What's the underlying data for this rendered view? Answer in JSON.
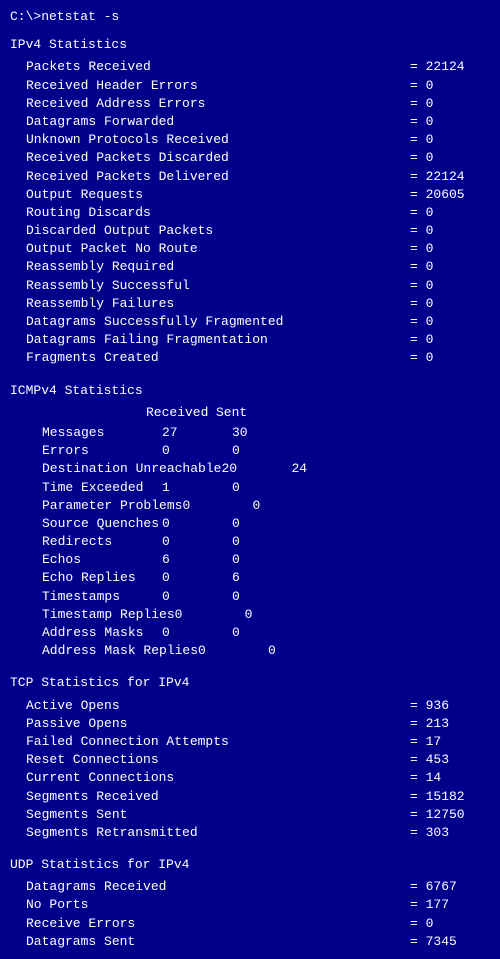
{
  "cmd": "C:\\>netstat -s",
  "sections": {
    "ipv4": {
      "header": "IPv4 Statistics",
      "stats": [
        {
          "label": "Packets Received",
          "value": "= 22124"
        },
        {
          "label": "Received Header Errors",
          "value": "= 0"
        },
        {
          "label": "Received Address Errors",
          "value": "= 0"
        },
        {
          "label": "Datagrams Forwarded",
          "value": "= 0"
        },
        {
          "label": "Unknown Protocols Received",
          "value": "= 0"
        },
        {
          "label": "Received Packets Discarded",
          "value": "= 0"
        },
        {
          "label": "Received Packets Delivered",
          "value": "= 22124"
        },
        {
          "label": "Output Requests",
          "value": "= 20605"
        },
        {
          "label": "Routing Discards",
          "value": "= 0"
        },
        {
          "label": "Discarded Output Packets",
          "value": "= 0"
        },
        {
          "label": "Output Packet No Route",
          "value": "= 0"
        },
        {
          "label": "Reassembly Required",
          "value": "= 0"
        },
        {
          "label": "Reassembly Successful",
          "value": "= 0"
        },
        {
          "label": "Reassembly Failures",
          "value": "= 0"
        },
        {
          "label": "Datagrams Successfully Fragmented",
          "value": "= 0"
        },
        {
          "label": "Datagrams Failing Fragmentation",
          "value": "= 0"
        },
        {
          "label": "Fragments Created",
          "value": "= 0"
        }
      ]
    },
    "icmpv4": {
      "header": "ICMPv4 Statistics",
      "col_received": "Received",
      "col_sent": "Sent",
      "rows": [
        {
          "label": "Messages",
          "received": "27",
          "sent": "30"
        },
        {
          "label": "Errors",
          "received": "0",
          "sent": "0"
        },
        {
          "label": "Destination Unreachable",
          "received": "20",
          "sent": "24"
        },
        {
          "label": "Time Exceeded",
          "received": "1",
          "sent": "0"
        },
        {
          "label": "Parameter Problems",
          "received": "0",
          "sent": "0"
        },
        {
          "label": "Source Quenches",
          "received": "0",
          "sent": "0"
        },
        {
          "label": "Redirects",
          "received": "0",
          "sent": "0"
        },
        {
          "label": "Echos",
          "received": "6",
          "sent": "0"
        },
        {
          "label": "Echo Replies",
          "received": "0",
          "sent": "6"
        },
        {
          "label": "Timestamps",
          "received": "0",
          "sent": "0"
        },
        {
          "label": "Timestamp Replies",
          "received": "0",
          "sent": "0"
        },
        {
          "label": "Address Masks",
          "received": "0",
          "sent": "0"
        },
        {
          "label": "Address Mask Replies",
          "received": "0",
          "sent": "0"
        }
      ]
    },
    "tcp": {
      "header": "TCP Statistics for IPv4",
      "stats": [
        {
          "label": "Active Opens",
          "value": "= 936"
        },
        {
          "label": "Passive Opens",
          "value": "= 213"
        },
        {
          "label": "Failed Connection Attempts",
          "value": "= 17"
        },
        {
          "label": "Reset Connections",
          "value": "= 453"
        },
        {
          "label": "Current Connections",
          "value": "= 14"
        },
        {
          "label": "Segments Received",
          "value": "= 15182"
        },
        {
          "label": "Segments Sent",
          "value": "= 12750"
        },
        {
          "label": "Segments Retransmitted",
          "value": "= 303"
        }
      ]
    },
    "udp": {
      "header": "UDP Statistics for IPv4",
      "stats": [
        {
          "label": "Datagrams Received",
          "value": "= 6767"
        },
        {
          "label": "No Ports",
          "value": "= 177"
        },
        {
          "label": "Receive Errors",
          "value": "= 0"
        },
        {
          "label": "Datagrams Sent",
          "value": "= 7345"
        }
      ]
    }
  }
}
